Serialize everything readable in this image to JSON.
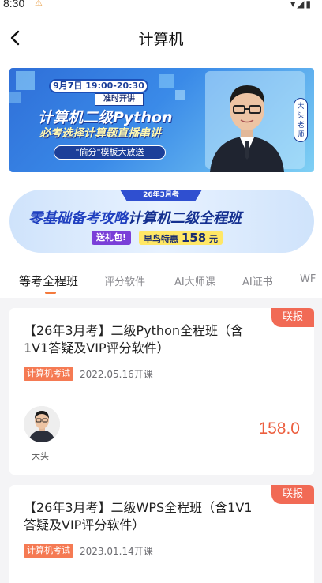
{
  "status_bar": {
    "time": "8:30"
  },
  "header": {
    "title": "计算机"
  },
  "banner1": {
    "date_time": "9月7日 19:00-20:30",
    "live_tag": "准时开讲",
    "title_line1": "计算机二级Python",
    "title_line2": "必考选择计算题直播串讲",
    "subtitle": "\"偷分\"模板大放送",
    "teacher_tag": "大头老师"
  },
  "banner2": {
    "top_tag": "26年3月考",
    "main_text_1": "零基础备考攻略",
    "main_text_2": "计算机二级全程班",
    "gift_label": "送礼包!",
    "early_label": "早鸟特惠",
    "early_price": "158",
    "early_unit": "元"
  },
  "tabs": [
    {
      "label": "等考全程班",
      "active": true
    },
    {
      "label": "评分软件",
      "active": false
    },
    {
      "label": "AI大师课",
      "active": false
    },
    {
      "label": "AI证书",
      "active": false
    },
    {
      "label": "WF",
      "active": false
    }
  ],
  "courses": [
    {
      "ribbon": "联报",
      "title": "【26年3月考】二级Python全程班（含1V1答疑及VIP评分软件）",
      "badge": "计算机考试",
      "date": "2022.05.16开课",
      "teacher": "大头",
      "price": "158.0"
    },
    {
      "ribbon": "联报",
      "title": "【26年3月考】二级WPS全程班（含1V1答疑及VIP评分软件）",
      "badge": "计算机考试",
      "date": "2023.01.14开课"
    }
  ],
  "colors": {
    "accent": "#f47a3d",
    "ribbon": "#f16a55",
    "price": "#ec5e3e",
    "badge": "#f57a53"
  }
}
